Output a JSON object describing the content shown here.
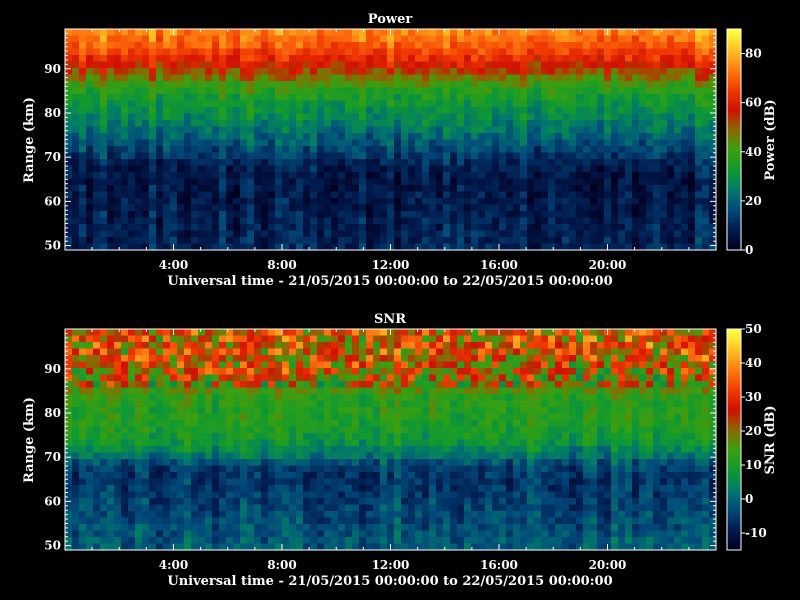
{
  "colors": {
    "background": "#000000",
    "text": "#ffffff",
    "colormap": [
      "#000020",
      "#001a4d",
      "#004a7a",
      "#007a6a",
      "#109a30",
      "#3aa010",
      "#8a6a00",
      "#d01000",
      "#f03a00",
      "#ff7a10",
      "#ffc020",
      "#ffff40"
    ]
  },
  "chart_data": [
    {
      "type": "heatmap",
      "title": "Power",
      "xlabel": "Universal time - 21/05/2015 00:00:00 to 22/05/2015 00:00:00",
      "ylabel": "Range (km)",
      "xlim": [
        0,
        24
      ],
      "ylim": [
        49,
        99
      ],
      "x_tick_labels": [
        "4:00",
        "8:00",
        "12:00",
        "16:00",
        "20:00"
      ],
      "x_tick_hours": [
        4,
        8,
        12,
        16,
        20
      ],
      "y_tick_labels": [
        "50",
        "60",
        "70",
        "80",
        "90"
      ],
      "y_tick_values": [
        50,
        60,
        70,
        80,
        90
      ],
      "colorbar_label": "Power (dB)",
      "colorbar_range": [
        0,
        90
      ],
      "colorbar_tick_labels": [
        "0",
        "20",
        "40",
        "60",
        "80"
      ],
      "colorbar_tick_values": [
        0,
        20,
        40,
        60,
        80
      ],
      "profile": [
        {
          "range": 98,
          "value": 75
        },
        {
          "range": 95,
          "value": 70
        },
        {
          "range": 92,
          "value": 62
        },
        {
          "range": 89,
          "value": 52
        },
        {
          "range": 86,
          "value": 40
        },
        {
          "range": 83,
          "value": 34
        },
        {
          "range": 80,
          "value": 30
        },
        {
          "range": 77,
          "value": 25
        },
        {
          "range": 74,
          "value": 20
        },
        {
          "range": 71,
          "value": 15
        },
        {
          "range": 68,
          "value": 9
        },
        {
          "range": 65,
          "value": 7
        },
        {
          "range": 62,
          "value": 8
        },
        {
          "range": 59,
          "value": 8
        },
        {
          "range": 56,
          "value": 9
        },
        {
          "range": 53,
          "value": 10
        },
        {
          "range": 50,
          "value": 10
        }
      ]
    },
    {
      "type": "heatmap",
      "title": "SNR",
      "xlabel": "Universal time - 21/05/2015 00:00:00 to 22/05/2015 00:00:00",
      "ylabel": "Range (km)",
      "xlim": [
        0,
        24
      ],
      "ylim": [
        49,
        99
      ],
      "x_tick_labels": [
        "4:00",
        "8:00",
        "12:00",
        "16:00",
        "20:00"
      ],
      "x_tick_hours": [
        4,
        8,
        12,
        16,
        20
      ],
      "y_tick_labels": [
        "50",
        "60",
        "70",
        "80",
        "90"
      ],
      "y_tick_values": [
        50,
        60,
        70,
        80,
        90
      ],
      "colorbar_label": "SNR (dB)",
      "colorbar_range": [
        -15,
        50
      ],
      "colorbar_tick_labels": [
        "-10",
        "0",
        "10",
        "20",
        "30",
        "40",
        "50"
      ],
      "colorbar_tick_values": [
        -10,
        0,
        10,
        20,
        30,
        40,
        50
      ],
      "profile": [
        {
          "range": 98,
          "value": 28
        },
        {
          "range": 95,
          "value": 27
        },
        {
          "range": 92,
          "value": 26
        },
        {
          "range": 89,
          "value": 24
        },
        {
          "range": 86,
          "value": 18
        },
        {
          "range": 83,
          "value": 12
        },
        {
          "range": 80,
          "value": 12
        },
        {
          "range": 77,
          "value": 11
        },
        {
          "range": 74,
          "value": 9
        },
        {
          "range": 71,
          "value": 4
        },
        {
          "range": 68,
          "value": -4
        },
        {
          "range": 65,
          "value": -6
        },
        {
          "range": 62,
          "value": -5
        },
        {
          "range": 59,
          "value": -4
        },
        {
          "range": 56,
          "value": -3
        },
        {
          "range": 53,
          "value": -2
        },
        {
          "range": 50,
          "value": -1
        }
      ]
    }
  ]
}
